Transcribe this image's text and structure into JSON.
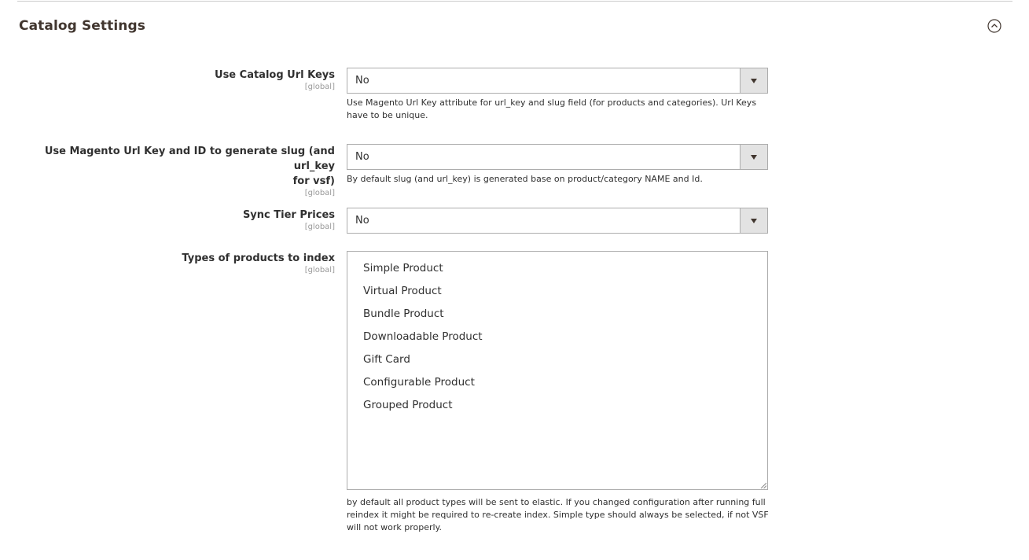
{
  "section": {
    "title": "Catalog Settings"
  },
  "fields": [
    {
      "label": "Use Catalog Url Keys",
      "scope": "[global]",
      "value": "No",
      "note": "Use Magento Url Key attribute for url_key and slug field (for products and categories). Url Keys have to be unique."
    },
    {
      "label_line1": "Use Magento Url Key and ID to generate slug (and url_key",
      "label_line2": "for vsf)",
      "scope": "[global]",
      "value": "No",
      "note": "By default slug (and url_key) is generated base on product/category NAME and Id."
    },
    {
      "label": "Sync Tier Prices",
      "scope": "[global]",
      "value": "No"
    },
    {
      "label": "Types of products to index",
      "scope": "[global]",
      "options": [
        "Simple Product",
        "Virtual Product",
        "Bundle Product",
        "Downloadable Product",
        "Gift Card",
        "Configurable Product",
        "Grouped Product"
      ],
      "note": "by default all product types will be sent to elastic. If you changed configuration after running full reindex it might be required to re-create index. Simple type should always be selected, if not VSF will not work properly."
    }
  ],
  "icons": {
    "collapse": "chevron-up-circle-icon",
    "dropdown": "triangle-down-icon",
    "resize": "resize-grip-icon"
  }
}
